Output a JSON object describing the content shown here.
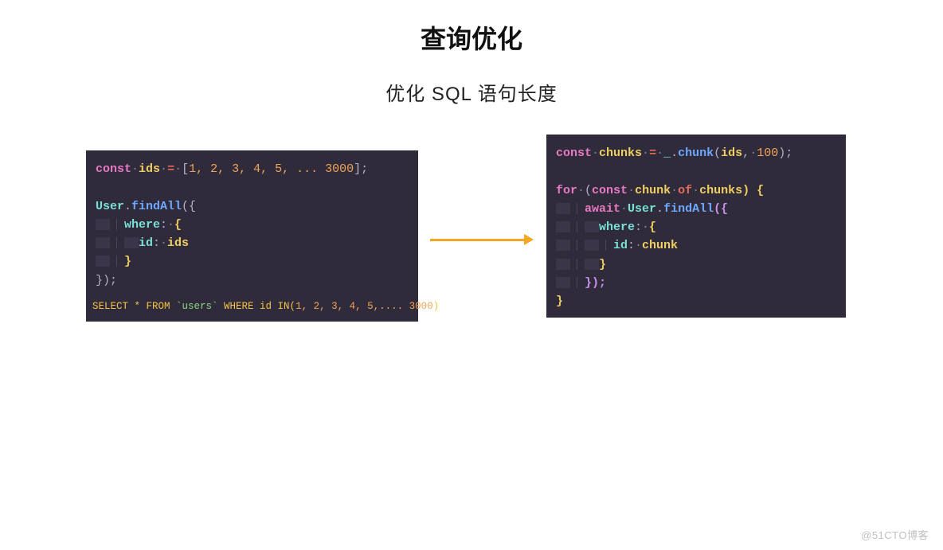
{
  "title": "查询优化",
  "subtitle": "优化 SQL 语句长度",
  "left_code": {
    "l1": {
      "kw": "const",
      "name": "ids",
      "eq": "=",
      "open": "[",
      "nums": "1, 2, 3, 4, 5, ... 3000",
      "close": "];"
    },
    "l3": {
      "obj": "User",
      "dot": ".",
      "fn": "findAll",
      "open": "({"
    },
    "l4": {
      "key": "where",
      "colon": ":",
      "brace": "{"
    },
    "l5": {
      "key": "id",
      "colon": ":",
      "val": "ids"
    },
    "l6": {
      "brace": "}"
    },
    "l7": {
      "close": "});"
    },
    "sql": {
      "pre": "SELECT * FROM ",
      "tbl": "`users`",
      "mid": " WHERE id IN(",
      "nums": "1, 2, 3, 4, 5,.... 3000",
      "end": ")"
    }
  },
  "right_code": {
    "l1": {
      "kw": "const",
      "name": "chunks",
      "eq": "=",
      "underscore": "_",
      "dot": ".",
      "fn": "chunk",
      "args_open": "(",
      "arg1": "ids",
      "comma": ",",
      "arg2": "100",
      "args_close": ");"
    },
    "l3": {
      "kw": "for",
      "open": "(",
      "kw2": "const",
      "iter": "chunk",
      "kw3": "of",
      "coll": "chunks",
      "close": ") {"
    },
    "l4": {
      "kw": "await",
      "obj": "User",
      "dot": ".",
      "fn": "findAll",
      "open": "({"
    },
    "l5": {
      "key": "where",
      "colon": ":",
      "brace": "{"
    },
    "l6": {
      "key": "id",
      "colon": ":",
      "val": "chunk"
    },
    "l7": {
      "brace": "}"
    },
    "l8": {
      "close": "});"
    },
    "l9": {
      "brace": "}"
    }
  },
  "watermark": "@51CTO博客"
}
